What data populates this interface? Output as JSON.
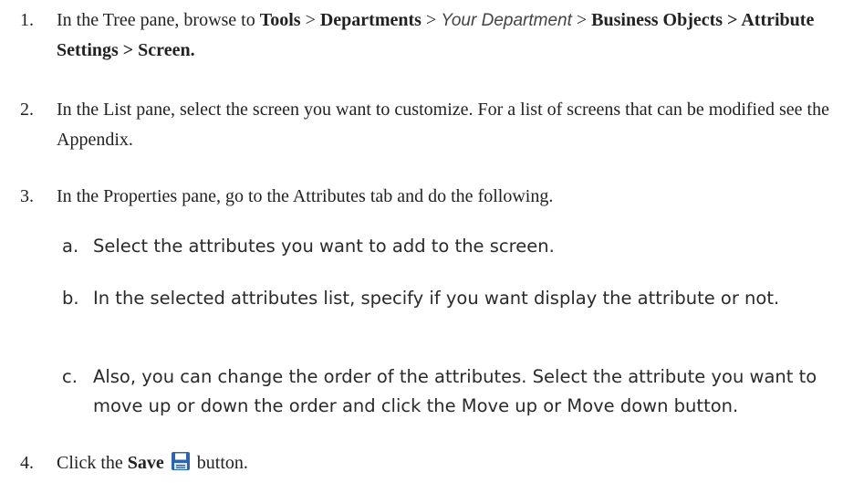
{
  "steps": [
    {
      "num": "1.",
      "parts": [
        "In the Tree pane, browse to ",
        "Tools",
        " > ",
        "Departments",
        " > ",
        "Your Department",
        " > ",
        "Business Objects > Attribute Settings > Screen."
      ]
    },
    {
      "num": "2.",
      "text": "In the List pane, select the screen you want to customize. For a list of screens that can be modified see the Appendix."
    },
    {
      "num": "3.",
      "text": "In the Properties pane, go to the Attributes tab and do the following.",
      "substeps": [
        {
          "letter": "a.",
          "text": "Select the attributes you want to add to the screen."
        },
        {
          "letter": "b.",
          "text": "In the selected attributes list, specify if you want display the attribute or not."
        },
        {
          "letter": "c.",
          "text": "Also, you can change the order of the attributes. Select the attribute you want to move up or down the order and click the Move up or Move down button."
        }
      ]
    },
    {
      "num": "4.",
      "parts": [
        "Click the ",
        "Save",
        " button."
      ],
      "icon": "save-icon"
    }
  ],
  "colors": {
    "text": "#222222",
    "icon_blue": "#2b63b5"
  }
}
